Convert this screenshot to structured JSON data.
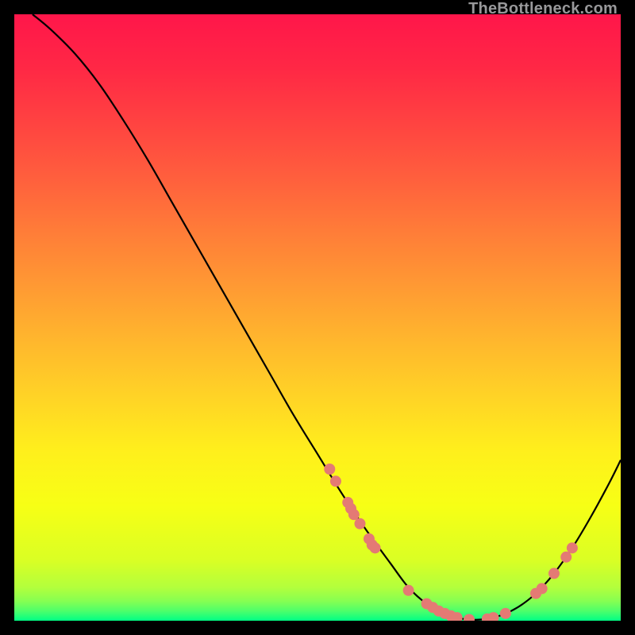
{
  "watermark": "TheBottleneck.com",
  "chart_data": {
    "type": "line",
    "title": "",
    "xlabel": "",
    "ylabel": "",
    "xlim": [
      0,
      100
    ],
    "ylim": [
      0,
      100
    ],
    "background_gradient": {
      "stops": [
        {
          "offset": 0.0,
          "color": "#ff164a"
        },
        {
          "offset": 0.09,
          "color": "#ff2845"
        },
        {
          "offset": 0.18,
          "color": "#ff4341"
        },
        {
          "offset": 0.27,
          "color": "#ff5f3d"
        },
        {
          "offset": 0.36,
          "color": "#ff7d38"
        },
        {
          "offset": 0.45,
          "color": "#ff9a33"
        },
        {
          "offset": 0.54,
          "color": "#ffb72d"
        },
        {
          "offset": 0.63,
          "color": "#ffd326"
        },
        {
          "offset": 0.72,
          "color": "#ffef1c"
        },
        {
          "offset": 0.81,
          "color": "#f7ff15"
        },
        {
          "offset": 0.9,
          "color": "#daff24"
        },
        {
          "offset": 0.945,
          "color": "#b3ff3c"
        },
        {
          "offset": 0.968,
          "color": "#85ff52"
        },
        {
          "offset": 0.984,
          "color": "#4dff6b"
        },
        {
          "offset": 1.0,
          "color": "#00ff85"
        }
      ]
    },
    "series": [
      {
        "name": "bottleneck-curve",
        "color": "#000000",
        "x": [
          3,
          6,
          10,
          14,
          18,
          22,
          26,
          30,
          34,
          38,
          42,
          46,
          50,
          54,
          58,
          62,
          65,
          68,
          71,
          74,
          77,
          80,
          83,
          86,
          89,
          92,
          95,
          98,
          100
        ],
        "y": [
          100,
          97.5,
          93.5,
          88.5,
          82.5,
          76,
          69,
          62,
          55,
          48,
          41,
          34,
          27.5,
          21,
          15,
          9.5,
          5.5,
          2.8,
          1.2,
          0.3,
          0.2,
          0.8,
          2.2,
          4.5,
          7.8,
          12,
          17,
          22.5,
          26.5
        ]
      }
    ],
    "scatter_points": {
      "color": "#e47a74",
      "radius": 7,
      "points": [
        {
          "x": 52,
          "y": 25
        },
        {
          "x": 53,
          "y": 23
        },
        {
          "x": 55,
          "y": 19.5
        },
        {
          "x": 55.5,
          "y": 18.5
        },
        {
          "x": 56,
          "y": 17.5
        },
        {
          "x": 57,
          "y": 16
        },
        {
          "x": 58.5,
          "y": 13.5
        },
        {
          "x": 59,
          "y": 12.5
        },
        {
          "x": 59.5,
          "y": 12
        },
        {
          "x": 65,
          "y": 5
        },
        {
          "x": 68,
          "y": 2.8
        },
        {
          "x": 69,
          "y": 2.2
        },
        {
          "x": 70,
          "y": 1.6
        },
        {
          "x": 71,
          "y": 1.2
        },
        {
          "x": 72,
          "y": 0.8
        },
        {
          "x": 73,
          "y": 0.5
        },
        {
          "x": 75,
          "y": 0.2
        },
        {
          "x": 78,
          "y": 0.3
        },
        {
          "x": 79,
          "y": 0.5
        },
        {
          "x": 81,
          "y": 1.2
        },
        {
          "x": 86,
          "y": 4.5
        },
        {
          "x": 87,
          "y": 5.3
        },
        {
          "x": 89,
          "y": 7.8
        },
        {
          "x": 91,
          "y": 10.5
        },
        {
          "x": 92,
          "y": 12
        }
      ]
    }
  }
}
